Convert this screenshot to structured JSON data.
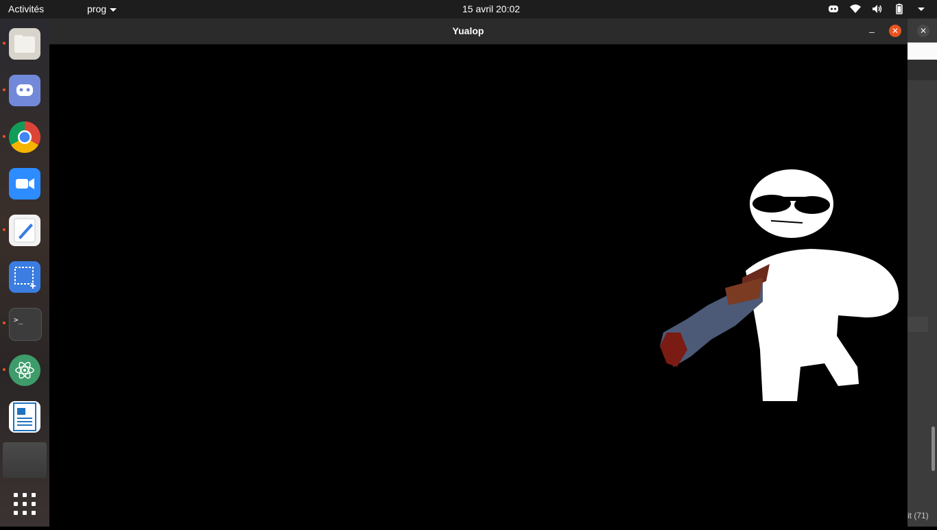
{
  "topbar": {
    "activities": "Activités",
    "app_menu": "prog",
    "clock": "15 avril  20:02",
    "tray_icons": [
      "discord-icon",
      "wifi-icon",
      "volume-icon",
      "battery-icon",
      "menu-caret-icon"
    ]
  },
  "dock": {
    "items": [
      "files",
      "discord",
      "chrome",
      "zoom",
      "text-editor",
      "screenshot",
      "terminal",
      "atom",
      "libreoffice-writer",
      "active-window",
      "show-applications"
    ]
  },
  "window": {
    "title": "Yualop",
    "minimize_label": "–",
    "close_label": "✕"
  },
  "side_window": {
    "close_label": "✕",
    "status_text": "it (71)"
  },
  "colors": {
    "accent": "#e95420",
    "topbar": "#1d1d1d",
    "titlebar": "#2b2b2b",
    "canvas": "#000000"
  }
}
